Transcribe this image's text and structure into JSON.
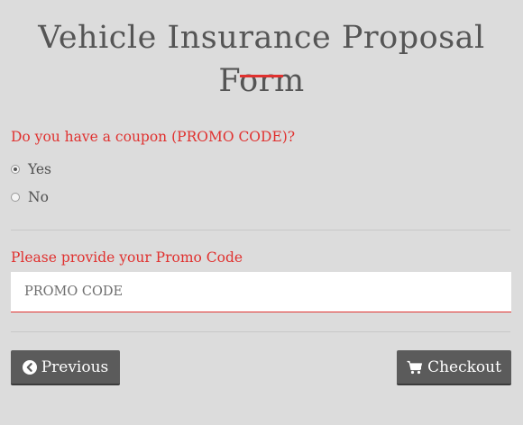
{
  "form": {
    "title": "Vehicle Insurance Proposal Form",
    "accent_color": "#e0312f"
  },
  "coupon": {
    "question": "Do you have a coupon (PROMO CODE)?",
    "options": [
      {
        "label": "Yes",
        "checked": true
      },
      {
        "label": "No",
        "checked": false
      }
    ]
  },
  "promo": {
    "label": "Please provide your Promo Code",
    "placeholder": "PROMO CODE",
    "value": ""
  },
  "buttons": {
    "previous_label": "Previous",
    "previous_icon": "chevron-circle-left-icon",
    "checkout_label": "Checkout",
    "checkout_icon": "shopping-cart-icon"
  }
}
